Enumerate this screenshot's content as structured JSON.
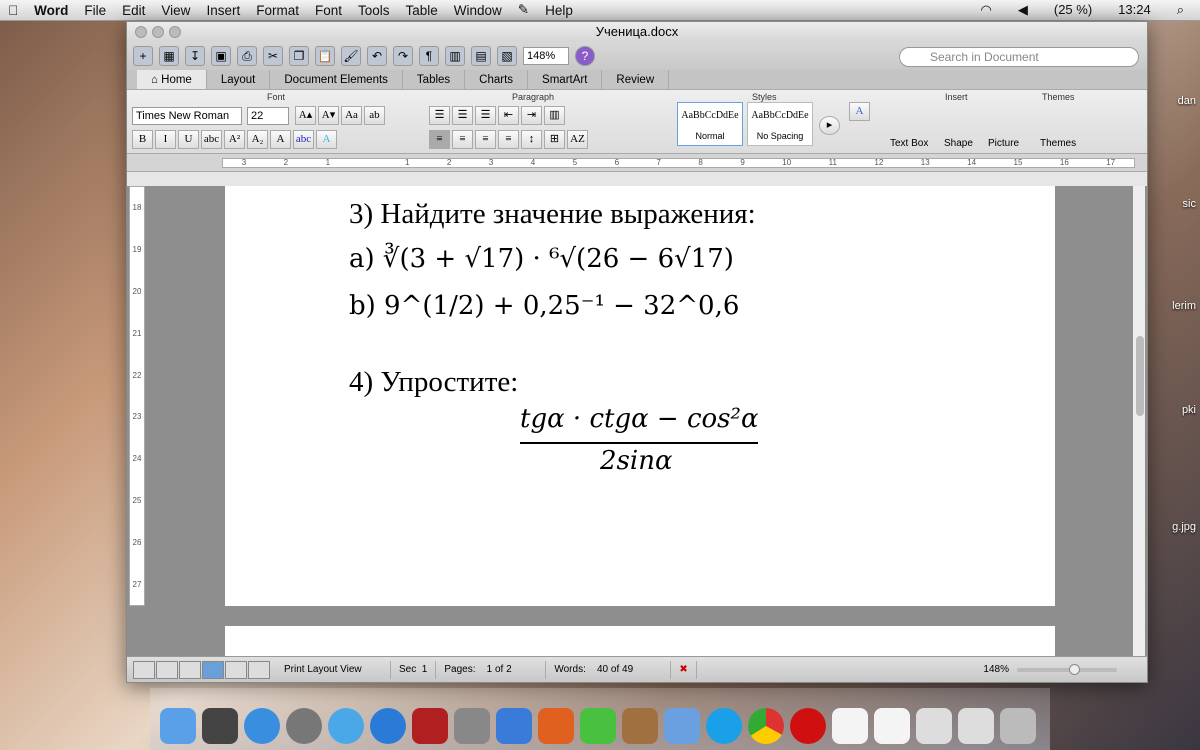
{
  "menubar": {
    "app": "Word",
    "items": [
      "File",
      "Edit",
      "View",
      "Insert",
      "Format",
      "Font",
      "Tools",
      "Table",
      "Window",
      "Help"
    ],
    "battery": "(25 %)",
    "time": "13:24"
  },
  "window": {
    "title": "Ученица.docx",
    "zoom": "148%",
    "search_placeholder": "Search in Document"
  },
  "tabs": [
    "Home",
    "Layout",
    "Document Elements",
    "Tables",
    "Charts",
    "SmartArt",
    "Review"
  ],
  "ribbon": {
    "groups": {
      "font": "Font",
      "paragraph": "Paragraph",
      "styles": "Styles",
      "insert": "Insert",
      "themes": "Themes"
    },
    "font_name": "Times New Roman",
    "font_size": "22",
    "styles": [
      {
        "preview": "AaBbCcDdEe",
        "name": "Normal"
      },
      {
        "preview": "AaBbCcDdEe",
        "name": "No Spacing"
      }
    ],
    "insert": [
      "Text Box",
      "Shape",
      "Picture"
    ],
    "themes": "Themes"
  },
  "ruler": [
    "3",
    "2",
    "1",
    "",
    "1",
    "2",
    "3",
    "4",
    "5",
    "6",
    "7",
    "8",
    "9",
    "10",
    "11",
    "12",
    "13",
    "14",
    "15",
    "16",
    "17"
  ],
  "vruler": [
    "18",
    "19",
    "20",
    "21",
    "22",
    "23",
    "24",
    "25",
    "26",
    "27"
  ],
  "document": {
    "q3": "3) Найдите значение выражения:",
    "a": "a) ∛(3 + √17) · ⁶√(26 − 6√17)",
    "b": "b) 9^(1/2) + 0,25⁻¹ − 32^0,6",
    "q4": "4) Упростите:",
    "numerator": "tgα · ctgα − cos²α",
    "denominator": "2sinα"
  },
  "status": {
    "view": "Print Layout View",
    "sec_label": "Sec",
    "sec": "1",
    "pages_label": "Pages:",
    "pages": "1 of 2",
    "words_label": "Words:",
    "words": "40 of 49",
    "zoom": "148%"
  },
  "desktop": [
    "dan",
    "sic",
    "lerim",
    "pki",
    "g.jpg"
  ]
}
